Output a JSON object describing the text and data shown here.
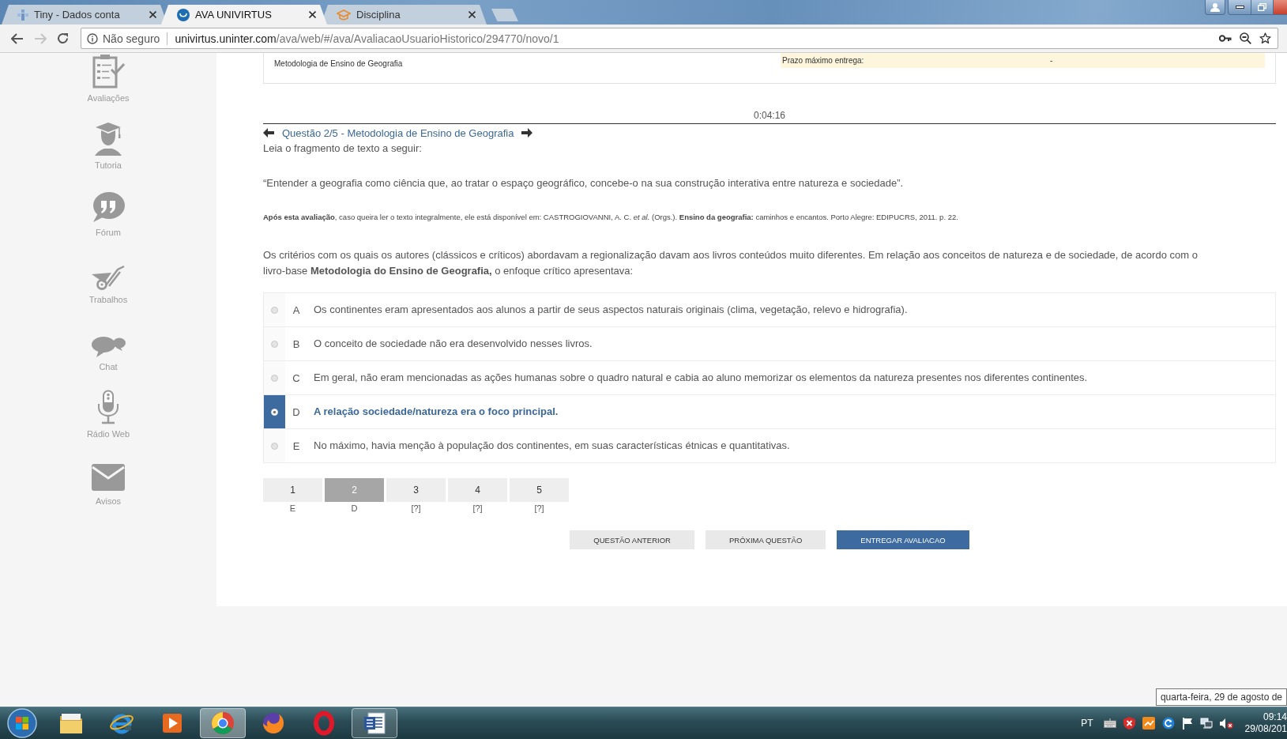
{
  "browser": {
    "tabs": [
      {
        "title": "Tiny - Dados conta",
        "selected": false
      },
      {
        "title": "AVA UNIVIRTUS",
        "selected": true
      },
      {
        "title": "Disciplina",
        "selected": false
      }
    ],
    "forward_disabled": true,
    "address": {
      "security": "Não seguro",
      "host": "univirtus.uninter.com",
      "path": "/ava/web/#/ava/AvaliacaoUsuarioHistorico/294770/novo/1"
    }
  },
  "sidebar": {
    "items": [
      {
        "label": "Avaliações"
      },
      {
        "label": "Tutoria"
      },
      {
        "label": "Fórum"
      },
      {
        "label": "Trabalhos"
      },
      {
        "label": "Chat"
      },
      {
        "label": "Rádio Web"
      },
      {
        "label": "Avisos"
      }
    ]
  },
  "assessment": {
    "discipline": "Metodologia de Ensino de Geografia",
    "deadline_label": "Prazo máximo entrega:",
    "deadline_value": "-"
  },
  "timer": "0:04:16",
  "question": {
    "title": "Questão 2/5 - Metodologia de Ensino de Geografia",
    "intro": "Leia o fragmento de texto a seguir:",
    "quote": "“Entender a geografia como ciência que, ao tratar o espaço geográfico, concebe-o na sua construção interativa entre natureza e sociedade”.",
    "reference": "**Após esta avaliação**, caso queira ler o texto integralmente, ele está disponível em: CASTROGIOVANNI, A. C. *et al.* (Orgs.). **Ensino da geografia:** caminhos e encantos. Porto Alegre: EDIPUCRS, 2011. p. 22.",
    "prompt": "Os critérios com os quais os autores (clássicos e críticos) abordavam a regionalização davam aos livros conteúdos muito diferentes. Em relação aos conceitos de natureza e de sociedade, de acordo com o livro-base **Metodologia do Ensino de Geografia,** o enfoque crítico apresentava:"
  },
  "options": [
    {
      "letter": "A",
      "text": "Os continentes eram apresentados aos alunos a partir de seus aspectos naturais originais (clima, vegetação, relevo e hidrografia).",
      "selected": false
    },
    {
      "letter": "B",
      "text": "O conceito de sociedade não era desenvolvido nesses livros.",
      "selected": false
    },
    {
      "letter": "C",
      "text": "Em geral, não eram mencionadas as ações humanas sobre o quadro natural e cabia ao aluno memorizar os elementos da natureza presentes nos diferentes continentes.",
      "selected": false
    },
    {
      "letter": "D",
      "text": "A relação sociedade/natureza era o foco principal.",
      "selected": true
    },
    {
      "letter": "E",
      "text": "No máximo, havia menção à população dos continentes, em suas características étnicas e quantitativas.",
      "selected": false
    }
  ],
  "question_nav": [
    {
      "number": "1",
      "answer": "E",
      "selected": false
    },
    {
      "number": "2",
      "answer": "D",
      "selected": true
    },
    {
      "number": "3",
      "answer": "[?]",
      "selected": false
    },
    {
      "number": "4",
      "answer": "[?]",
      "selected": false
    },
    {
      "number": "5",
      "answer": "[?]",
      "selected": false
    }
  ],
  "buttons": [
    {
      "label": "QUESTÃO ANTERIOR",
      "kind": "secondary"
    },
    {
      "label": "PRÓXIMA QUESTÃO",
      "kind": "secondary"
    },
    {
      "label": "ENTREGAR AVALIACAO",
      "kind": "primary"
    }
  ],
  "tooltip": "quarta-feira, 29 de agosto de",
  "taskbar": {
    "apps": [
      {
        "highlighted": false
      },
      {
        "highlighted": false
      },
      {
        "highlighted": false
      },
      {
        "highlighted": true
      },
      {
        "highlighted": false
      },
      {
        "highlighted": false
      },
      {
        "highlighted": true
      }
    ],
    "language": "PT",
    "time": "09:14",
    "date": "29/08/201"
  }
}
